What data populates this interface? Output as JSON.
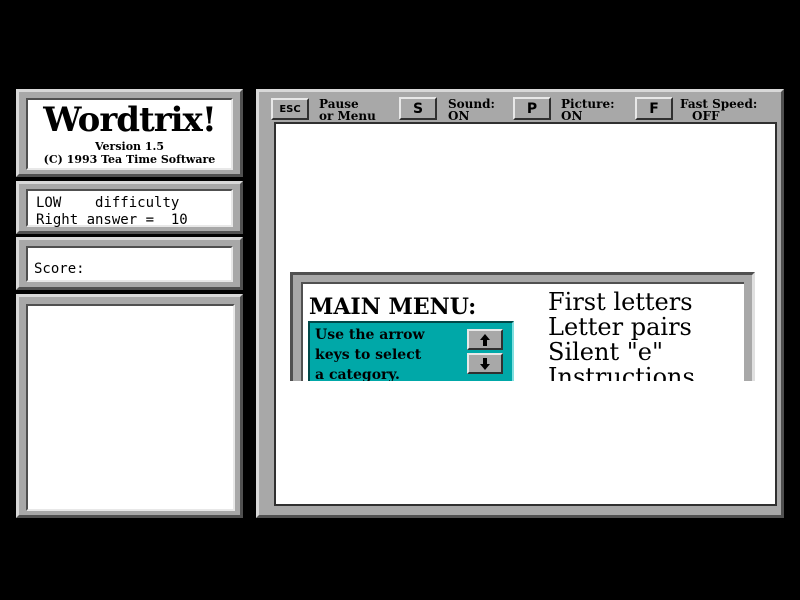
{
  "logo": {
    "title": "Wordtrix!",
    "version": "Version 1.5",
    "copyright": "(C) 1993 Tea Time Software"
  },
  "difficulty": {
    "level": "LOW",
    "label": "difficulty",
    "right_answer_label": "Right answer =",
    "right_answer_value": "10"
  },
  "score": {
    "label": "Score:"
  },
  "toolbar": {
    "esc": {
      "key": "ESC",
      "label_1": "Pause",
      "label_2": "or Menu"
    },
    "sound": {
      "key": "S",
      "label": "Sound:",
      "value": "ON"
    },
    "picture": {
      "key": "P",
      "label": "Picture:",
      "value": "ON"
    },
    "speed": {
      "key": "F",
      "label": "Fast Speed:",
      "value": "OFF"
    }
  },
  "main_menu": {
    "heading": "MAIN MENU:",
    "instructions": [
      "Use the arrow",
      "keys to select",
      "a category."
    ],
    "items": [
      "First letters",
      "Letter pairs",
      "Silent \"e\"",
      "Instructions"
    ],
    "up_icon": "arrow-up-icon",
    "down_icon": "arrow-down-icon"
  },
  "colors": {
    "panel": "#a8a8a8",
    "teal": "#00a8a8",
    "background": "#000000"
  }
}
